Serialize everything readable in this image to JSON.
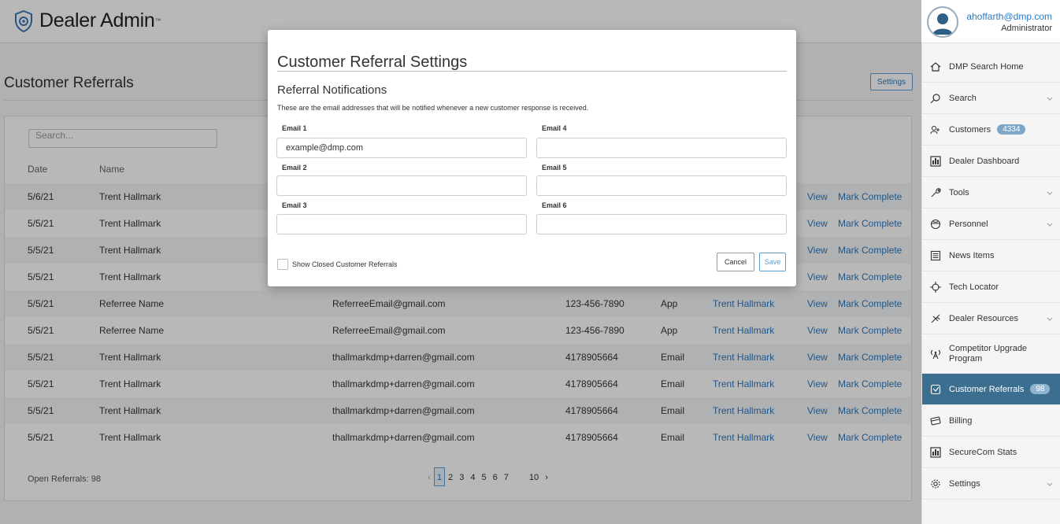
{
  "brand": {
    "title": "Dealer Admin",
    "tm": "™"
  },
  "user": {
    "email": "ahoffarth@dmp.com",
    "role": "Administrator"
  },
  "page": {
    "title": "Customer Referrals",
    "settings_label": "Settings"
  },
  "search": {
    "placeholder": "Search..."
  },
  "columns": [
    "Date",
    "Name"
  ],
  "rows": [
    {
      "date": "5/6/21",
      "name": "Trent Hallmark",
      "email": "",
      "phone": "",
      "source": "",
      "assigned": "",
      "view": "View",
      "action": "Mark Complete"
    },
    {
      "date": "5/5/21",
      "name": "Trent Hallmark",
      "email": "",
      "phone": "",
      "source": "",
      "assigned": "",
      "view": "View",
      "action": "Mark Complete"
    },
    {
      "date": "5/5/21",
      "name": "Trent Hallmark",
      "email": "",
      "phone": "",
      "source": "",
      "assigned": "",
      "view": "View",
      "action": "Mark Complete"
    },
    {
      "date": "5/5/21",
      "name": "Trent Hallmark",
      "email": "",
      "phone": "",
      "source": "",
      "assigned": "",
      "view": "View",
      "action": "Mark Complete"
    },
    {
      "date": "5/5/21",
      "name": "Referree Name",
      "email": "ReferreeEmail@gmail.com",
      "phone": "123-456-7890",
      "source": "App",
      "assigned": "Trent Hallmark",
      "view": "View",
      "action": "Mark Complete"
    },
    {
      "date": "5/5/21",
      "name": "Referree Name",
      "email": "ReferreeEmail@gmail.com",
      "phone": "123-456-7890",
      "source": "App",
      "assigned": "Trent Hallmark",
      "view": "View",
      "action": "Mark Complete"
    },
    {
      "date": "5/5/21",
      "name": "Trent Hallmark",
      "email": "thallmarkdmp+darren@gmail.com",
      "phone": "4178905664",
      "source": "Email",
      "assigned": "Trent Hallmark",
      "view": "View",
      "action": "Mark Complete"
    },
    {
      "date": "5/5/21",
      "name": "Trent Hallmark",
      "email": "thallmarkdmp+darren@gmail.com",
      "phone": "4178905664",
      "source": "Email",
      "assigned": "Trent Hallmark",
      "view": "View",
      "action": "Mark Complete"
    },
    {
      "date": "5/5/21",
      "name": "Trent Hallmark",
      "email": "thallmarkdmp+darren@gmail.com",
      "phone": "4178905664",
      "source": "Email",
      "assigned": "Trent Hallmark",
      "view": "View",
      "action": "Mark Complete"
    },
    {
      "date": "5/5/21",
      "name": "Trent Hallmark",
      "email": "thallmarkdmp+darren@gmail.com",
      "phone": "4178905664",
      "source": "Email",
      "assigned": "Trent Hallmark",
      "view": "View",
      "action": "Mark Complete"
    }
  ],
  "footer": {
    "open_referrals": "Open Referrals: 98"
  },
  "pagination": {
    "prev": "‹",
    "pages": [
      "1",
      "2",
      "3",
      "4",
      "5",
      "6",
      "7"
    ],
    "ellipsis": "...",
    "last": "10",
    "next": "›",
    "current": "1"
  },
  "sidebar": {
    "items": [
      {
        "label": "DMP Search Home",
        "icon": "home-icon",
        "badge": "",
        "chevron": false
      },
      {
        "label": "Search",
        "icon": "search-icon",
        "badge": "",
        "chevron": true
      },
      {
        "label": "Customers",
        "icon": "customers-icon",
        "badge": "4334",
        "chevron": false
      },
      {
        "label": "Dealer Dashboard",
        "icon": "dashboard-icon",
        "badge": "",
        "chevron": false
      },
      {
        "label": "Tools",
        "icon": "wrench-icon",
        "badge": "",
        "chevron": true
      },
      {
        "label": "Personnel",
        "icon": "personnel-icon",
        "badge": "",
        "chevron": true
      },
      {
        "label": "News Items",
        "icon": "news-icon",
        "badge": "",
        "chevron": false
      },
      {
        "label": "Tech Locator",
        "icon": "locator-icon",
        "badge": "",
        "chevron": false
      },
      {
        "label": "Dealer Resources",
        "icon": "resources-icon",
        "badge": "",
        "chevron": true
      },
      {
        "label": "Competitor Upgrade Program",
        "icon": "antenna-icon",
        "badge": "",
        "chevron": false
      },
      {
        "label": "Customer Referrals",
        "icon": "referrals-icon",
        "badge": "98",
        "chevron": false,
        "active": true
      },
      {
        "label": "Billing",
        "icon": "billing-icon",
        "badge": "",
        "chevron": false
      },
      {
        "label": "SecureCom Stats",
        "icon": "stats-icon",
        "badge": "",
        "chevron": false
      },
      {
        "label": "Settings",
        "icon": "gear-icon",
        "badge": "",
        "chevron": true
      }
    ]
  },
  "modal": {
    "title": "Customer Referral Settings",
    "subtitle": "Referral Notifications",
    "description": "These are the email addresses that will be notified whenever a new customer response is received.",
    "fields": [
      {
        "label": "Email 1",
        "value": "example@dmp.com"
      },
      {
        "label": "Email 2",
        "value": ""
      },
      {
        "label": "Email 3",
        "value": ""
      },
      {
        "label": "Email 4",
        "value": ""
      },
      {
        "label": "Email 5",
        "value": ""
      },
      {
        "label": "Email 6",
        "value": ""
      }
    ],
    "checkbox_label": "Show Closed Customer Referrals",
    "cancel_label": "Cancel",
    "save_label": "Save"
  },
  "colors": {
    "accent": "#2b79c2",
    "sidebar_active": "#3c6e8f",
    "badge": "#7ea6c6"
  }
}
